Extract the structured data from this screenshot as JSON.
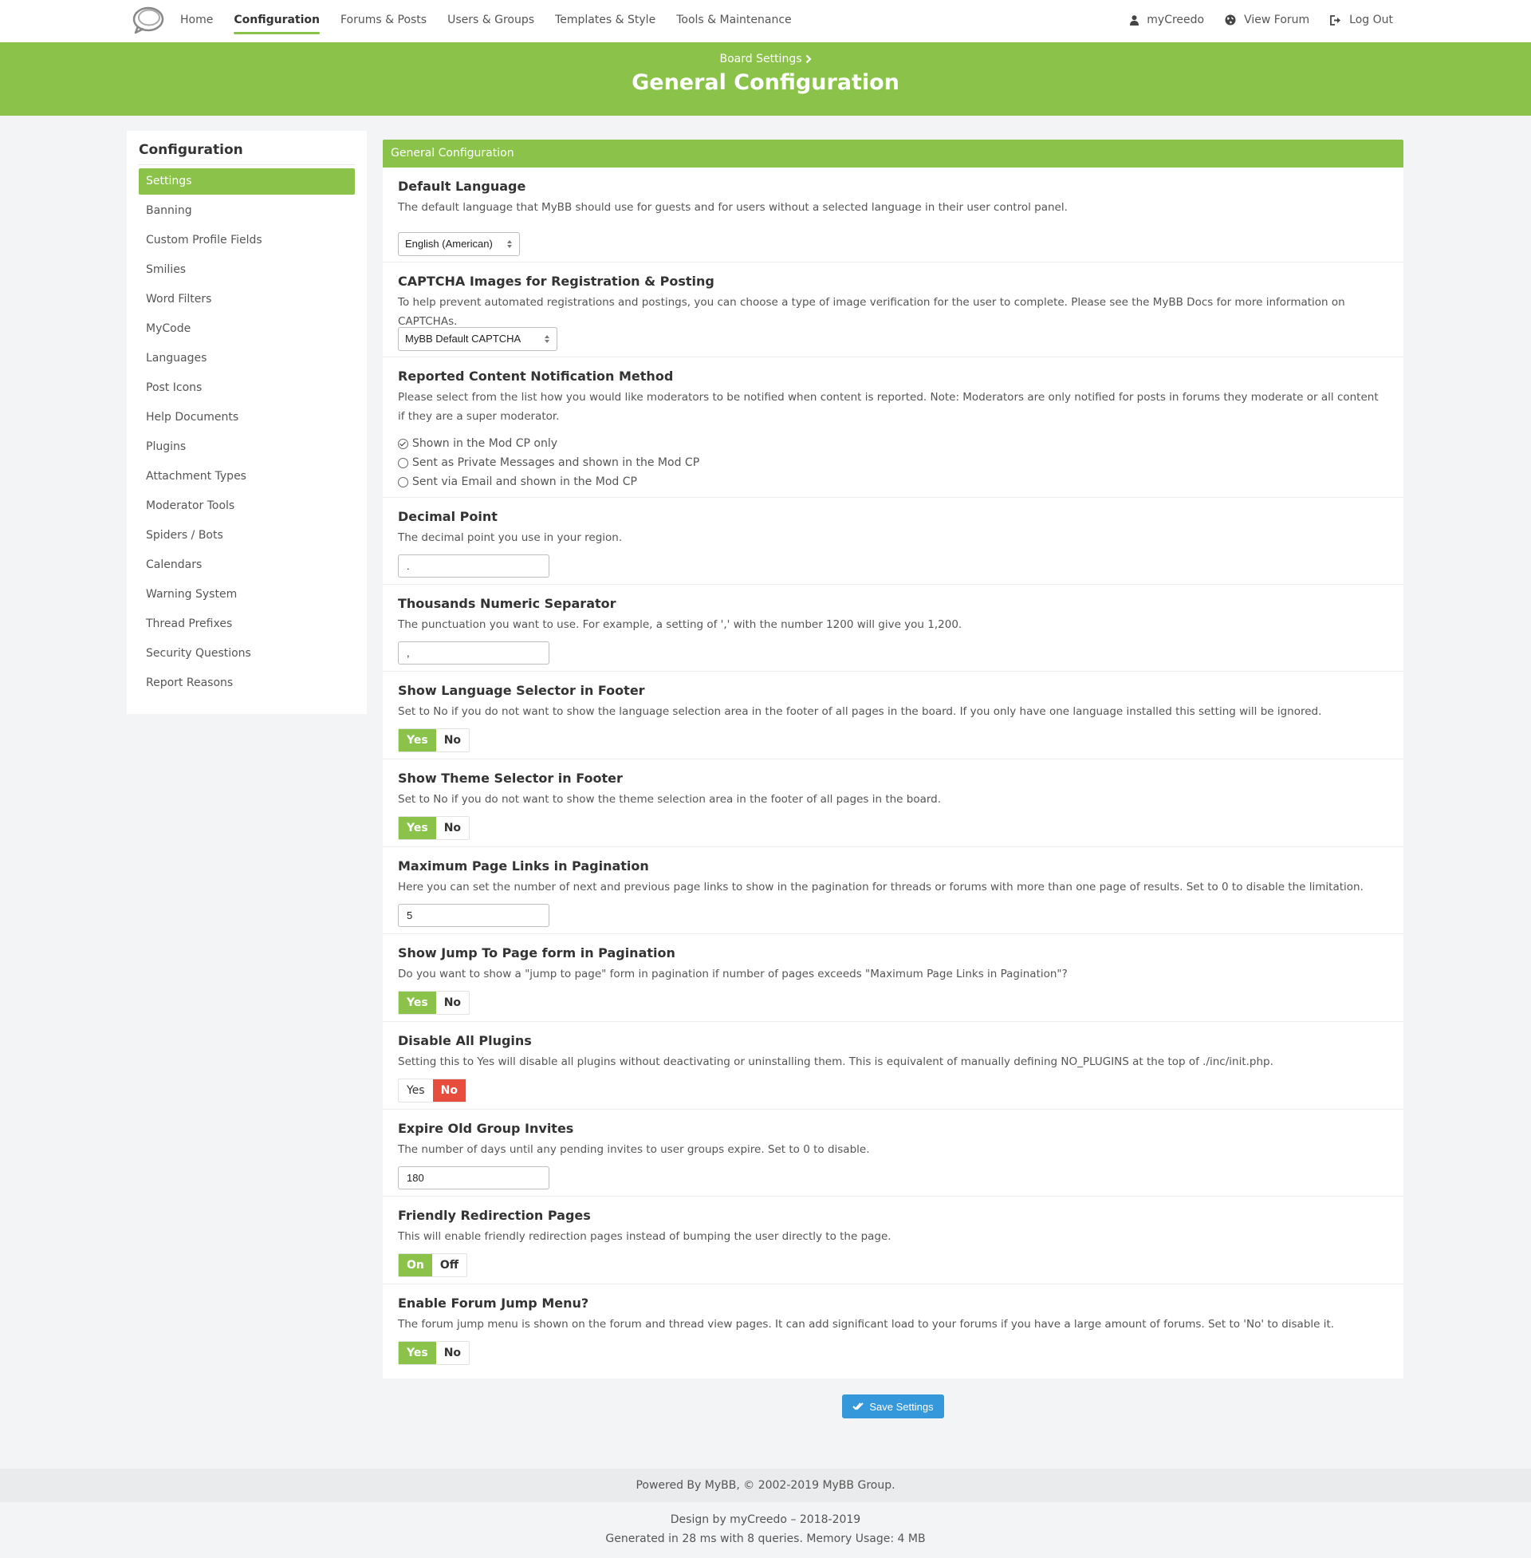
{
  "nav": {
    "items": [
      "Home",
      "Configuration",
      "Forums & Posts",
      "Users & Groups",
      "Templates & Style",
      "Tools & Maintenance"
    ],
    "active": "Configuration",
    "user": "myCreedo",
    "view_forum": "View Forum",
    "logout": "Log Out"
  },
  "header": {
    "breadcrumb": "Board Settings",
    "title": "General Configuration"
  },
  "sidebar": {
    "title": "Configuration",
    "items": [
      "Settings",
      "Banning",
      "Custom Profile Fields",
      "Smilies",
      "Word Filters",
      "MyCode",
      "Languages",
      "Post Icons",
      "Help Documents",
      "Plugins",
      "Attachment Types",
      "Moderator Tools",
      "Spiders / Bots",
      "Calendars",
      "Warning System",
      "Thread Prefixes",
      "Security Questions",
      "Report Reasons"
    ],
    "active": "Settings"
  },
  "panel": {
    "title": "General Configuration",
    "settings": [
      {
        "title": "Default Language",
        "desc": "The default language that MyBB should use for guests and for users without a selected language in their user control panel.",
        "select_value": "English (American)"
      },
      {
        "title": "CAPTCHA Images for Registration & Posting",
        "desc": "To help prevent automated registrations and postings, you can choose a type of image verification for the user to complete. Please see the MyBB Docs for more information on CAPTCHAs.",
        "select_value": "MyBB Default CAPTCHA"
      },
      {
        "title": "Reported Content Notification Method",
        "desc": "Please select from the list how you would like moderators to be notified when content is reported. Note: Moderators are only notified for posts in forums they moderate or all content if they are a super moderator.",
        "options": [
          "Shown in the Mod CP only",
          "Sent as Private Messages and shown in the Mod CP",
          "Sent via Email and shown in the Mod CP"
        ],
        "selected": "Shown in the Mod CP only"
      },
      {
        "title": "Decimal Point",
        "desc": "The decimal point you use in your region.",
        "value": "."
      },
      {
        "title": "Thousands Numeric Separator",
        "desc": "The punctuation you want to use. For example, a setting of ',' with the number 1200 will give you 1,200.",
        "value": ","
      },
      {
        "title": "Show Language Selector in Footer",
        "desc": "Set to No if you do not want to show the language selection area in the footer of all pages in the board. If you only have one language installed this setting will be ignored.",
        "yes": "Yes",
        "no": "No",
        "selected": "Yes"
      },
      {
        "title": "Show Theme Selector in Footer",
        "desc": "Set to No if you do not want to show the theme selection area in the footer of all pages in the board.",
        "yes": "Yes",
        "no": "No",
        "selected": "Yes"
      },
      {
        "title": "Maximum Page Links in Pagination",
        "desc": "Here you can set the number of next and previous page links to show in the pagination for threads or forums with more than one page of results. Set to 0 to disable the limitation.",
        "value": "5"
      },
      {
        "title": "Show Jump To Page form in Pagination",
        "desc": "Do you want to show a \"jump to page\" form in pagination if number of pages exceeds \"Maximum Page Links in Pagination\"?",
        "yes": "Yes",
        "no": "No",
        "selected": "Yes"
      },
      {
        "title": "Disable All Plugins",
        "desc": "Setting this to Yes will disable all plugins without deactivating or uninstalling them. This is equivalent of manually defining NO_PLUGINS at the top of ./inc/init.php.",
        "yes": "Yes",
        "no": "No",
        "selected": "No"
      },
      {
        "title": "Expire Old Group Invites",
        "desc": "The number of days until any pending invites to user groups expire. Set to 0 to disable.",
        "value": "180"
      },
      {
        "title": "Friendly Redirection Pages",
        "desc": "This will enable friendly redirection pages instead of bumping the user directly to the page.",
        "yes": "On",
        "no": "Off",
        "selected": "On"
      },
      {
        "title": "Enable Forum Jump Menu?",
        "desc": "The forum jump menu is shown on the forum and thread view pages. It can add significant load to your forums if you have a large amount of forums. Set to 'No' to disable it.",
        "yes": "Yes",
        "no": "No",
        "selected": "Yes"
      }
    ]
  },
  "save_label": "Save Settings",
  "footer": {
    "powered": "Powered By MyBB, © 2002-2019 MyBB Group.",
    "design": "Design by myCreedo – 2018-2019",
    "generated": "Generated in 28 ms with 8 queries. Memory Usage: 4 MB"
  },
  "colors": {
    "brand_green": "#8bc34a",
    "save_blue": "#3498db",
    "danger_red": "#e74c3c"
  },
  "icons": {
    "logo": "speech-bubbles-logo",
    "user": "user-icon",
    "view_forum": "globe-icon",
    "logout": "sign-out-icon",
    "breadcrumb": "chevron-right-icon",
    "save": "double-check-icon"
  }
}
